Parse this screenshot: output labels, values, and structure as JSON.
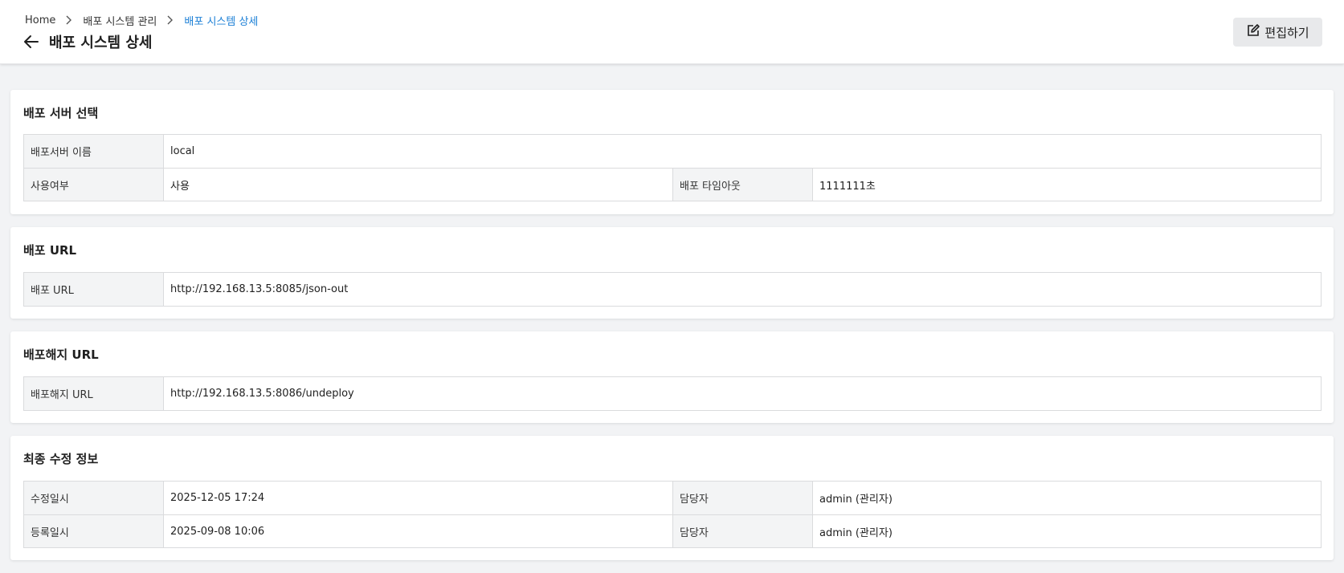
{
  "breadcrumb": {
    "home": "Home",
    "parent": "배포 시스템 관리",
    "current": "배포 시스템 상세"
  },
  "header": {
    "title": "배포 시스템 상세",
    "edit_label": "편집하기"
  },
  "sections": {
    "server": {
      "title": "배포 서버 선택",
      "name_label": "배포서버 이름",
      "name_value": "local",
      "use_label": "사용여부",
      "use_value": "사용",
      "timeout_label": "배포 타임아웃",
      "timeout_value": "1111111초"
    },
    "deploy_url": {
      "title": "배포 URL",
      "label": "배포 URL",
      "value": "http://192.168.13.5:8085/json-out"
    },
    "undeploy_url": {
      "title": "배포해지 URL",
      "label": "배포해지 URL",
      "value": "http://192.168.13.5:8086/undeploy"
    },
    "modified": {
      "title": "최종 수정 정보",
      "modified_label": "수정일시",
      "modified_value": "2025-12-05 17:24",
      "modified_manager_label": "담당자",
      "modified_manager_value": "admin (관리자)",
      "registered_label": "등록일시",
      "registered_value": "2025-09-08 10:06",
      "registered_manager_label": "담당자",
      "registered_manager_value": "admin (관리자)"
    }
  },
  "colors": {
    "accent": "#1b7fd6",
    "background": "#f2f3f5",
    "header_cell": "#f3f4f5",
    "border": "#dadbdd"
  },
  "icons": {
    "back": "arrow-left-icon",
    "edit": "edit-icon",
    "separator": "chevron-right-icon"
  }
}
